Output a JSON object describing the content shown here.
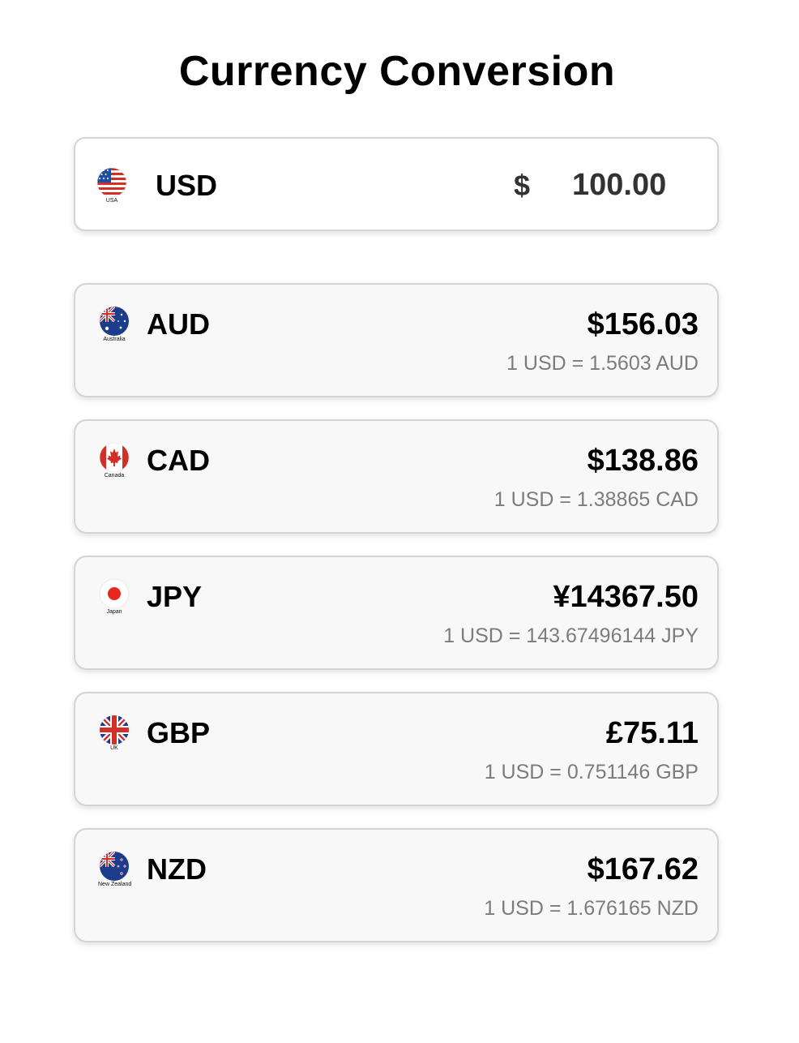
{
  "title": "Currency Conversion",
  "base": {
    "flag_icon": "usa-flag-icon",
    "flag_caption": "USA",
    "code": "USD",
    "symbol": "$",
    "amount": "100.00"
  },
  "results": [
    {
      "code": "AUD",
      "amount": "$156.03",
      "rate": "1 USD = 1.5603 AUD",
      "flag_icon": "australia-flag-icon",
      "flag_caption": "Australia"
    },
    {
      "code": "CAD",
      "amount": "$138.86",
      "rate": "1 USD = 1.38865 CAD",
      "flag_icon": "canada-flag-icon",
      "flag_caption": "Canada"
    },
    {
      "code": "JPY",
      "amount": "¥14367.50",
      "rate": "1 USD = 143.67496144 JPY",
      "flag_icon": "japan-flag-icon",
      "flag_caption": "Japan"
    },
    {
      "code": "GBP",
      "amount": "£75.11",
      "rate": "1 USD = 0.751146 GBP",
      "flag_icon": "uk-flag-icon",
      "flag_caption": "UK"
    },
    {
      "code": "NZD",
      "amount": "$167.62",
      "rate": "1 USD = 1.676165 NZD",
      "flag_icon": "new-zealand-flag-icon",
      "flag_caption": "New Zealand"
    }
  ],
  "colors": {
    "text": "#000000",
    "rate_text": "#7c7c7c",
    "card_border": "#d4d4d4",
    "result_card_bg": "#f8f8f8"
  }
}
